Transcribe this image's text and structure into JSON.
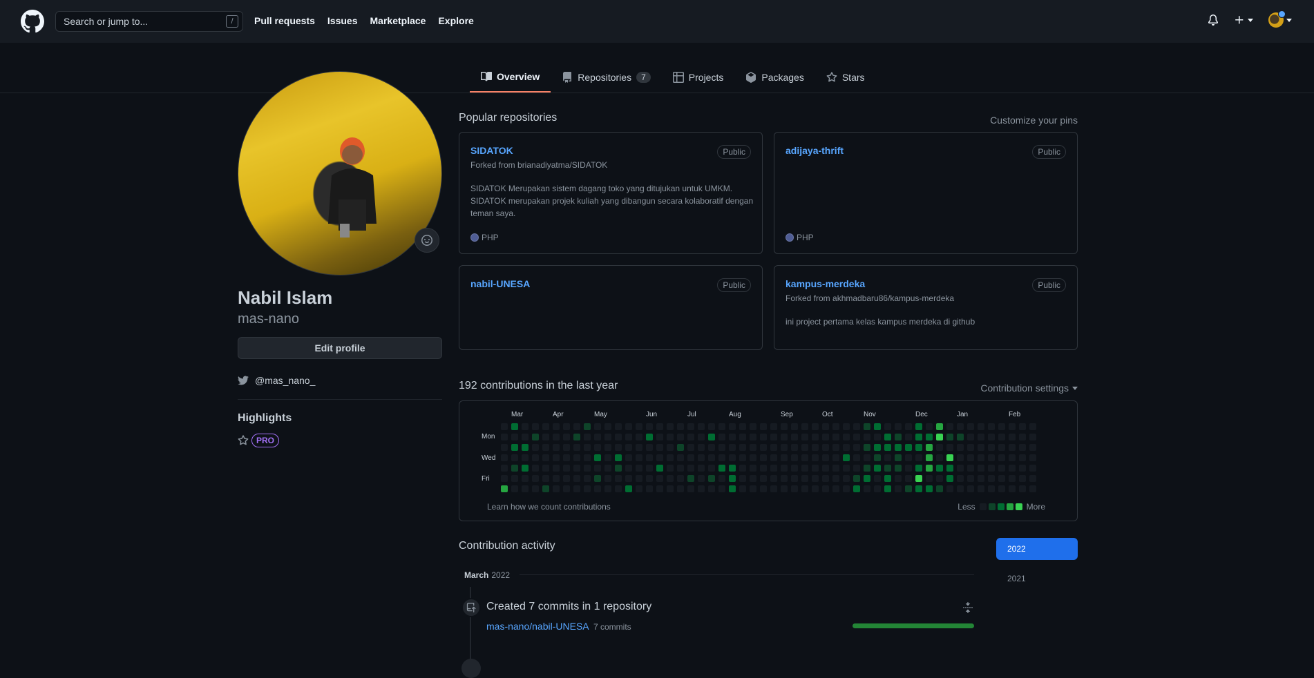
{
  "header": {
    "search_placeholder": "Search or jump to...",
    "search_key": "/",
    "nav": [
      "Pull requests",
      "Issues",
      "Marketplace",
      "Explore"
    ]
  },
  "tabs": [
    {
      "label": "Overview",
      "icon": "book-icon"
    },
    {
      "label": "Repositories",
      "icon": "repo-icon",
      "count": "7"
    },
    {
      "label": "Projects",
      "icon": "table-icon"
    },
    {
      "label": "Packages",
      "icon": "package-icon"
    },
    {
      "label": "Stars",
      "icon": "star-icon"
    }
  ],
  "profile": {
    "name": "Nabil Islam",
    "login": "mas-nano",
    "edit_label": "Edit profile",
    "twitter": "@mas_nano_",
    "highlights_title": "Highlights",
    "pro_label": "PRO"
  },
  "pinned": {
    "title": "Popular repositories",
    "customize": "Customize your pins",
    "items": [
      {
        "name": "SIDATOK",
        "visibility": "Public",
        "fork": "Forked from brianadiyatma/SIDATOK",
        "desc": "SIDATOK Merupakan sistem dagang toko yang ditujukan untuk UMKM. SIDATOK merupakan projek kuliah yang dibangun secara kolaboratif dengan teman saya.",
        "lang": "PHP"
      },
      {
        "name": "adijaya-thrift",
        "visibility": "Public",
        "fork": "",
        "desc": "",
        "lang": "PHP"
      },
      {
        "name": "nabil-UNESA",
        "visibility": "Public",
        "fork": "",
        "desc": "",
        "lang": ""
      },
      {
        "name": "kampus-merdeka",
        "visibility": "Public",
        "fork": "Forked from akhmadbaru86/kampus-merdeka",
        "desc": "ini project pertama kelas kampus merdeka di github",
        "lang": ""
      }
    ]
  },
  "contributions": {
    "title": "192 contributions in the last year",
    "settings": "Contribution settings",
    "months": [
      "Mar",
      "Apr",
      "May",
      "Jun",
      "Jul",
      "Aug",
      "Sep",
      "Oct",
      "Nov",
      "Dec",
      "Jan",
      "Feb"
    ],
    "days": [
      "Mon",
      "Wed",
      "Fri"
    ],
    "learn": "Learn how we count contributions",
    "less": "Less",
    "more": "More",
    "colors": [
      "#161b22",
      "#0e4429",
      "#006d32",
      "#26a641",
      "#39d353"
    ]
  },
  "activity": {
    "title": "Contribution activity",
    "years": [
      "2022",
      "2021"
    ],
    "month": "March",
    "year": "2022",
    "event_title": "Created 7 commits in 1 repository",
    "repo": "mas-nano/nabil-UNESA",
    "commits": "7 commits"
  }
}
